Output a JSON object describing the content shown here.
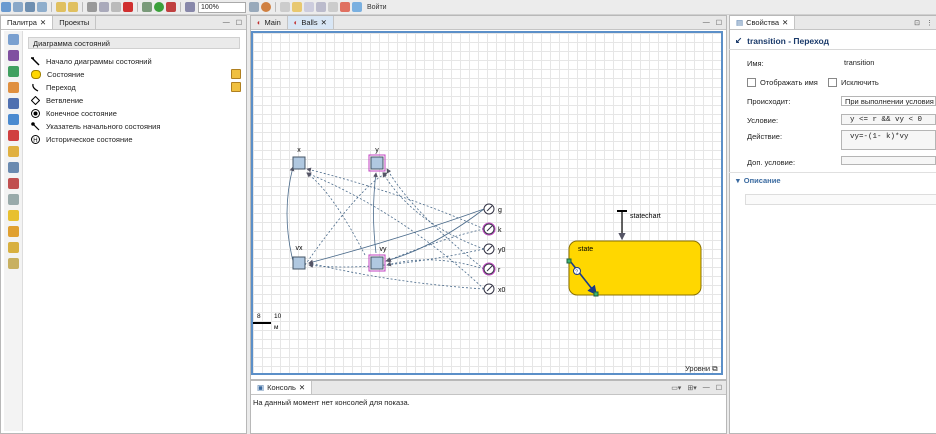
{
  "toolbar": {
    "zoom": "100%",
    "login": "Войти"
  },
  "palette": {
    "tabs": [
      "Палитра",
      "Проекты"
    ],
    "section": "Диаграмма состояний",
    "items": [
      "Начало диаграммы состояний",
      "Состояние",
      "Переход",
      "Ветвление",
      "Конечное состояние",
      "Указатель начального состояния",
      "Историческое состояние"
    ]
  },
  "editor": {
    "tabs": [
      "Main",
      "Balls"
    ],
    "levels": "Уровни",
    "scale": {
      "left": "8",
      "right": "10",
      "unit": "м"
    },
    "vars": {
      "x": "x",
      "y": "y",
      "vx": "vx",
      "vy": "vy"
    },
    "params": [
      "g",
      "k",
      "y0",
      "r",
      "x0"
    ],
    "statechart_label": "statechart",
    "state_label": "state",
    "state_color": "#FFD700"
  },
  "console": {
    "tab": "Консоль",
    "message": "На данный момент нет консолей для показа."
  },
  "properties": {
    "tab": "Свойства",
    "title": "transition - Переход",
    "name_label": "Имя:",
    "name_value": "transition",
    "show_name_label": "Отображать имя",
    "exclude_label": "Исключить",
    "occurs_label": "Происходит:",
    "occurs_value": "При выполнении условия",
    "condition_label": "Условие:",
    "condition_value": "y <= r && vy < 0",
    "action_label": "Действие:",
    "action_value": "vy=-(1- k)*vy",
    "guard_label": "Доп. условие:",
    "description_label": "Описание"
  }
}
